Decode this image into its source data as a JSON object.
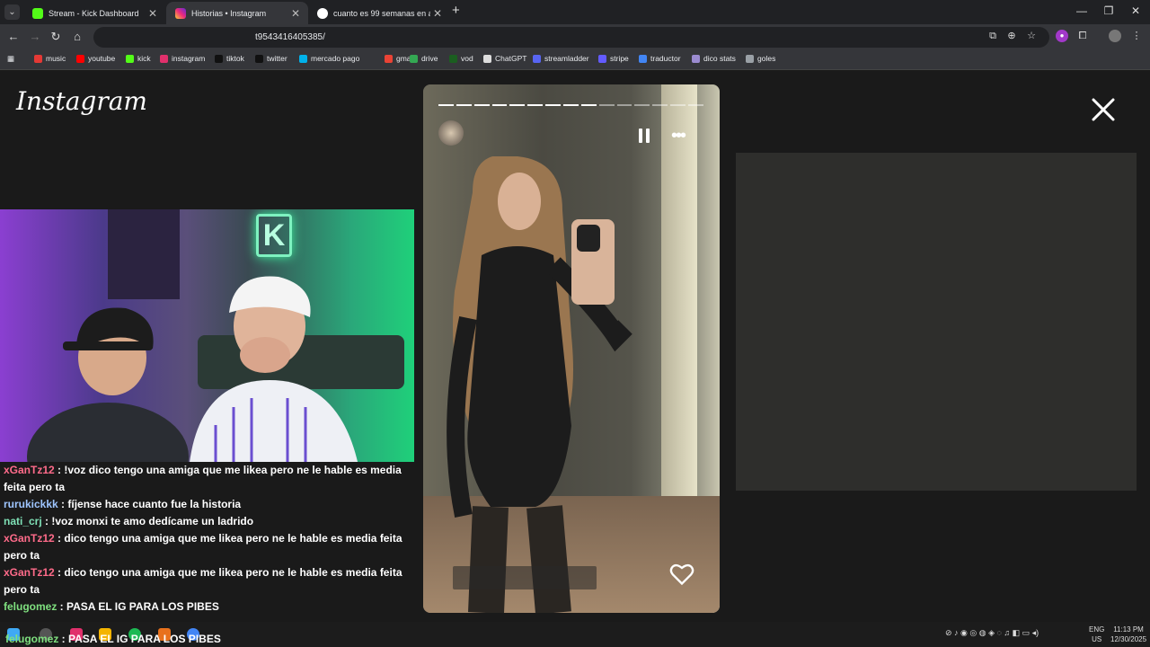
{
  "tabs": [
    {
      "label": "Stream - Kick Dashboard",
      "color": "#53fc18",
      "close": "✕"
    },
    {
      "label": "Historias • Instagram",
      "color": "#e1306c",
      "close": "✕"
    },
    {
      "label": "cuanto es 99 semanas en años",
      "color": "#4285f4",
      "close": "✕"
    }
  ],
  "toolbar": {
    "url": "t9543416405385/"
  },
  "bookmarks": [
    {
      "label": "music",
      "color": "#e53935"
    },
    {
      "label": "youtube",
      "color": "#ff0000"
    },
    {
      "label": "kick",
      "color": "#53fc18"
    },
    {
      "label": "instagram",
      "color": "#e1306c"
    },
    {
      "label": "tiktok",
      "color": "#111111"
    },
    {
      "label": "twitter",
      "color": "#111111"
    },
    {
      "label": "mercado pago",
      "color": "#00b1ea"
    },
    {
      "label": "gmail",
      "color": "#ea4335"
    },
    {
      "label": "drive",
      "color": "#34a853"
    },
    {
      "label": "vod",
      "color": "#1b5e20"
    },
    {
      "label": "ChatGPT",
      "color": "#dddddd"
    },
    {
      "label": "streamladder",
      "color": "#5865f2"
    },
    {
      "label": "stripe",
      "color": "#635bff"
    },
    {
      "label": "traductor",
      "color": "#4285f4"
    },
    {
      "label": "dico stats",
      "color": "#9b8bd0"
    },
    {
      "label": "goles",
      "color": "#9aa0a6"
    }
  ],
  "page": {
    "logo": "Instagram"
  },
  "chat": [
    {
      "user": "xGanTz12",
      "color": "#ff6b8a",
      "text": "!voz dico tengo una amiga que me likea pero ne le hable es media feita pero ta"
    },
    {
      "user": "rurukickkk",
      "color": "#9ec5ff",
      "text": "fíjense hace cuanto fue la historia"
    },
    {
      "user": "nati_crj",
      "color": "#7fe0b6",
      "text": "!voz monxi te amo dedícame un ladrido"
    },
    {
      "user": "xGanTz12",
      "color": "#ff6b8a",
      "text": "dico tengo una amiga que me likea pero ne le hable es media feita pero ta"
    },
    {
      "user": "xGanTz12",
      "color": "#ff6b8a",
      "text": "dico tengo una amiga que me likea pero ne le hable es media feita pero ta"
    },
    {
      "user": "felugomez",
      "color": "#7fe07f",
      "text": "PASA EL IG PARA LOS PIBES"
    }
  ],
  "overlay_chat": {
    "user": "felugomez",
    "color": "#7fe07f",
    "text": "PASA EL IG PARA LOS PIBES"
  },
  "story": {
    "segments_total": 15,
    "segments_done": 9
  },
  "taskbar": {
    "lang_top": "ENG",
    "lang_bottom": "US",
    "time": "11:13 PM",
    "date": "12/30/2025"
  }
}
